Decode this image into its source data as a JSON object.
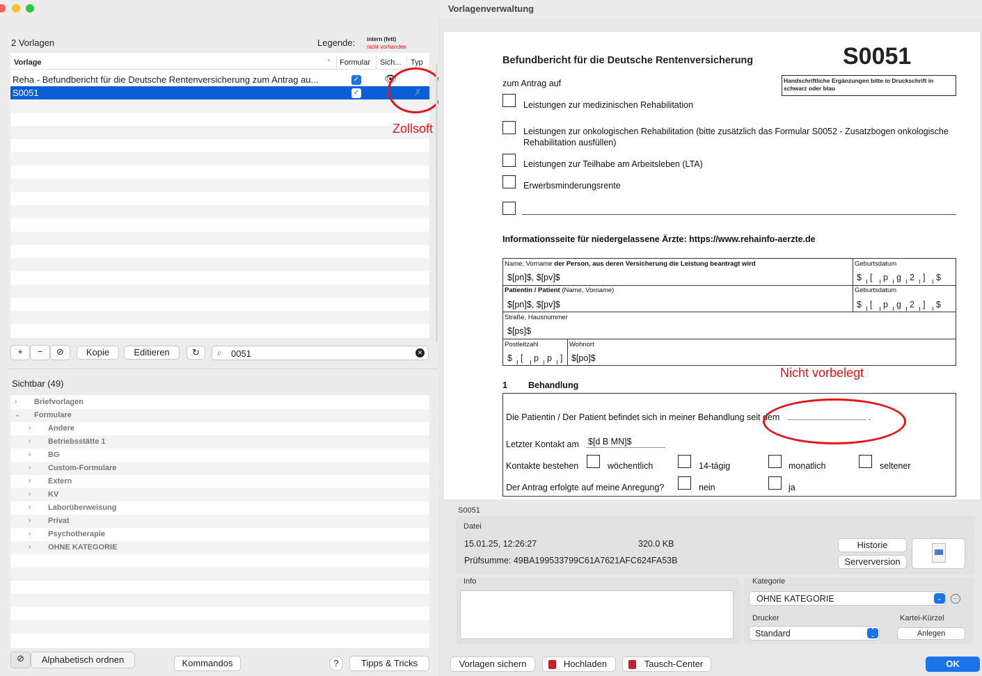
{
  "window": {
    "title": "Vorlagenverwaltung"
  },
  "left": {
    "count_label": "2 Vorlagen",
    "legend_label": "Legende:",
    "legend_intern": "intern (fett)",
    "legend_missing": "nicht vorhanden",
    "columns": {
      "vorlage": "Vorlage",
      "formular": "Formular",
      "sich": "Sich...",
      "typ": "Typ"
    },
    "rows": [
      {
        "name": "Reha - Befundbericht für die Deutsche Rentenversicherung zum Antrag au...",
        "formular": true
      },
      {
        "name": "S0051",
        "formular": true
      }
    ],
    "annotation_zollsoft": "Zollsoft",
    "toolbar": {
      "add": "+",
      "remove": "−",
      "copy": "Kopie",
      "edit": "Editieren",
      "refresh": "↻",
      "search_value": "0051"
    },
    "visible_label": "Sichtbar (49)",
    "tree": [
      {
        "label": "Briefvorlagen",
        "level": 0,
        "expanded": false
      },
      {
        "label": "Formulare",
        "level": 0,
        "expanded": true
      },
      {
        "label": "Andere",
        "level": 1,
        "expanded": false
      },
      {
        "label": "Betriebsstätte 1",
        "level": 1,
        "expanded": false
      },
      {
        "label": "BG",
        "level": 1,
        "expanded": false
      },
      {
        "label": "Custom-Formulare",
        "level": 1,
        "expanded": false
      },
      {
        "label": "Extern",
        "level": 1,
        "expanded": false
      },
      {
        "label": "KV",
        "level": 1,
        "expanded": false
      },
      {
        "label": "Laborüberweisung",
        "level": 1,
        "expanded": false
      },
      {
        "label": "Privat",
        "level": 1,
        "expanded": false
      },
      {
        "label": "Psychotherapie",
        "level": 1,
        "expanded": false
      },
      {
        "label": "OHNE KATEGORIE",
        "level": 1,
        "expanded": false
      }
    ],
    "bottom": {
      "sort": "Alphabetisch ordnen",
      "commands": "Kommandos",
      "help": "?",
      "tips": "Tipps & Tricks"
    }
  },
  "doc": {
    "heading": "Befundbericht für die Deutsche Rentenversicherung",
    "code": "S0051",
    "note": "Handschriftliche Ergänzungen bitte in Druckschrift in schwarz oder blau",
    "antrag": "zum Antrag auf",
    "options": [
      "Leistungen zur medizinischen Rehabilitation",
      "Leistungen zur onkologischen Rehabilitation (bitte zusätzlich das Formular S0052 - Zusatzbogen onkologische",
      "Rehabilitation ausfüllen)",
      "Leistungen zur Teilhabe am Arbeitsleben (LTA)",
      "Erwerbsminderungsrente"
    ],
    "info_line": "Informationsseite für niedergelassene Ärzte: https://www.rehainfo-aerzte.de",
    "fields": {
      "name_label_a": "Name, Vorname",
      "name_label_b": " der Person, aus deren Versicherung die Leistung beantragt wird",
      "name_value": "$[pn]$, $[pv]$",
      "gebdat_label": "Geburtsdatum",
      "gebdat_chars": [
        "$",
        "[",
        "p",
        "g",
        "2",
        "]",
        "$"
      ],
      "patient_label_a": "Patientin / Patient",
      "patient_label_b": " (Name, Vorname)",
      "patient_value": "$[pn]$, $[pv]$",
      "street_label": "Straße, Hausnummer",
      "street_value": "$[ps]$",
      "plz_label": "Postleitzahl",
      "plz_chars": [
        "$",
        "[",
        "p",
        "p",
        "]"
      ],
      "ort_label": "Wohnort",
      "ort_value": "$[po]$"
    },
    "section_num": "1",
    "section_title": "Behandlung",
    "annotation_nicht": "Nicht vorbelegt",
    "treatment_text": "Die Patientin / Der Patient befindet sich in meiner Behandlung seit dem",
    "last_contact_label": "Letzter Kontakt am",
    "last_contact_value": "$[d B MN]$",
    "contacts_label": "Kontakte bestehen",
    "freq": [
      "wöchentlich",
      "14-tägig",
      "monatlich",
      "seltener"
    ],
    "antrag_q": "Der Antrag erfolgte auf meine Anregung?",
    "answers": [
      "nein",
      "ja"
    ]
  },
  "details": {
    "name": "S0051",
    "file_label": "Datei",
    "date": "15.01.25, 12:26:27",
    "size": "320.0 KB",
    "checksum": "Prüfsumme: 49BA199533799C61A7621AFC624FA53B",
    "history_btn": "Historie",
    "server_btn": "Serverversion",
    "info_label": "Info",
    "kategorie_label": "Kategorie",
    "kategorie_value": "OHNE KATEGORIE",
    "drucker_label": "Drucker",
    "drucker_value": "Standard",
    "kartei_label": "Kartei-Kürzel",
    "anlegen_btn": "Anlegen"
  },
  "footer": {
    "save": "Vorlagen sichern",
    "upload": "Hochladen",
    "exchange": "Tausch-Center",
    "ok": "OK"
  },
  "colors": {
    "selection": "#0a5fd6",
    "annotation": "#e8141b",
    "accent": "#1a74e8"
  }
}
